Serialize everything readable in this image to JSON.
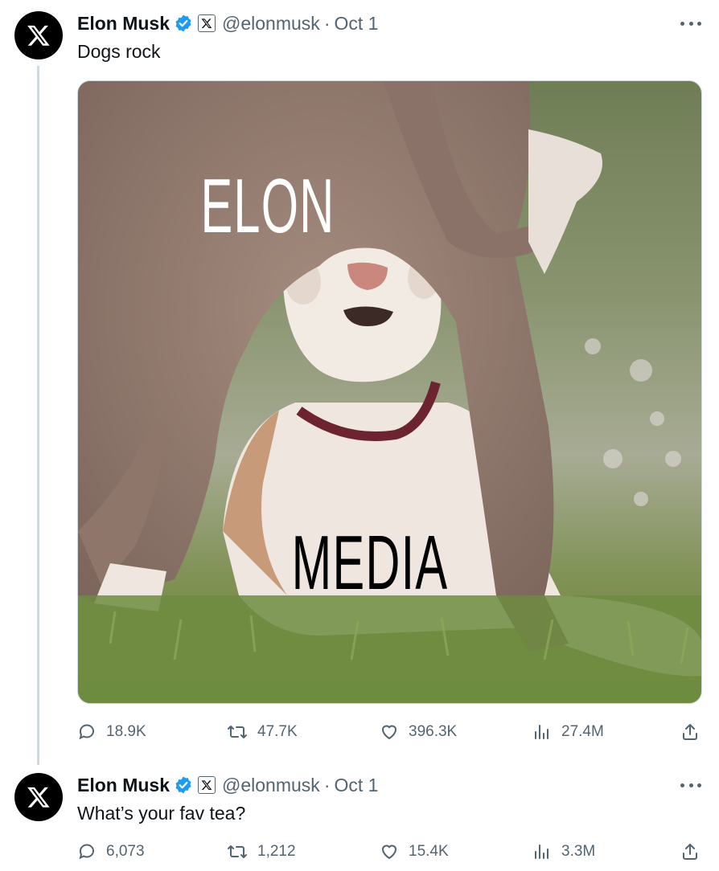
{
  "colors": {
    "text": "#0f1419",
    "muted": "#536471",
    "verified": "#1d9bf0",
    "line": "#cfd9de"
  },
  "tweets": [
    {
      "author": "Elon Musk",
      "handle": "@elonmusk",
      "separator": "·",
      "date": "Oct 1",
      "text": "Dogs rock",
      "media": {
        "top_caption": "ELON",
        "bottom_caption": "MEDIA"
      },
      "stats": {
        "replies": "18.9K",
        "retweets": "47.7K",
        "likes": "396.3K",
        "views": "27.4M"
      }
    },
    {
      "author": "Elon Musk",
      "handle": "@elonmusk",
      "separator": "·",
      "date": "Oct 1",
      "text": "What’s your fav tea?",
      "stats": {
        "replies": "6,073",
        "retweets": "1,212",
        "likes": "15.4K",
        "views": "3.3M"
      }
    }
  ],
  "icons": [
    "x-logo-avatar",
    "verified-badge-icon",
    "x-affiliate-badge-icon",
    "more-icon",
    "reply-icon",
    "retweet-icon",
    "like-icon",
    "views-icon",
    "share-icon"
  ]
}
